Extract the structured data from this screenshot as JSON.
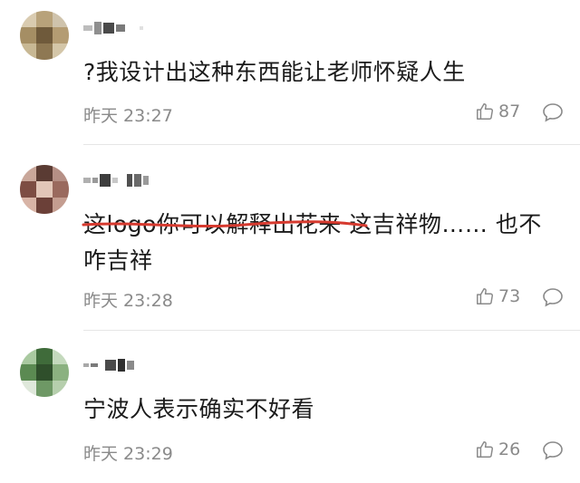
{
  "comments": [
    {
      "text": "?我设计出这种东西能让老师怀疑人生",
      "time": "昨天 23:27",
      "likes": "87",
      "like_icon": "thumbs-up-icon",
      "reply_icon": "comment-bubble-icon"
    },
    {
      "text_underlined": "这logo你可以解释出花来",
      "text_rest": " 这吉祥物…… 也不咋吉祥",
      "time": "昨天 23:28",
      "likes": "73",
      "underline_color": "#d63a2f",
      "like_icon": "thumbs-up-icon",
      "reply_icon": "comment-bubble-icon"
    },
    {
      "text": "宁波人表示确实不好看",
      "time": "昨天 23:29",
      "likes": "26",
      "like_icon": "thumbs-up-icon",
      "reply_icon": "comment-bubble-icon"
    }
  ],
  "colors": {
    "meta_gray": "#8a8a8a",
    "divider": "#e6e6e6",
    "text": "#1b1b1b"
  }
}
